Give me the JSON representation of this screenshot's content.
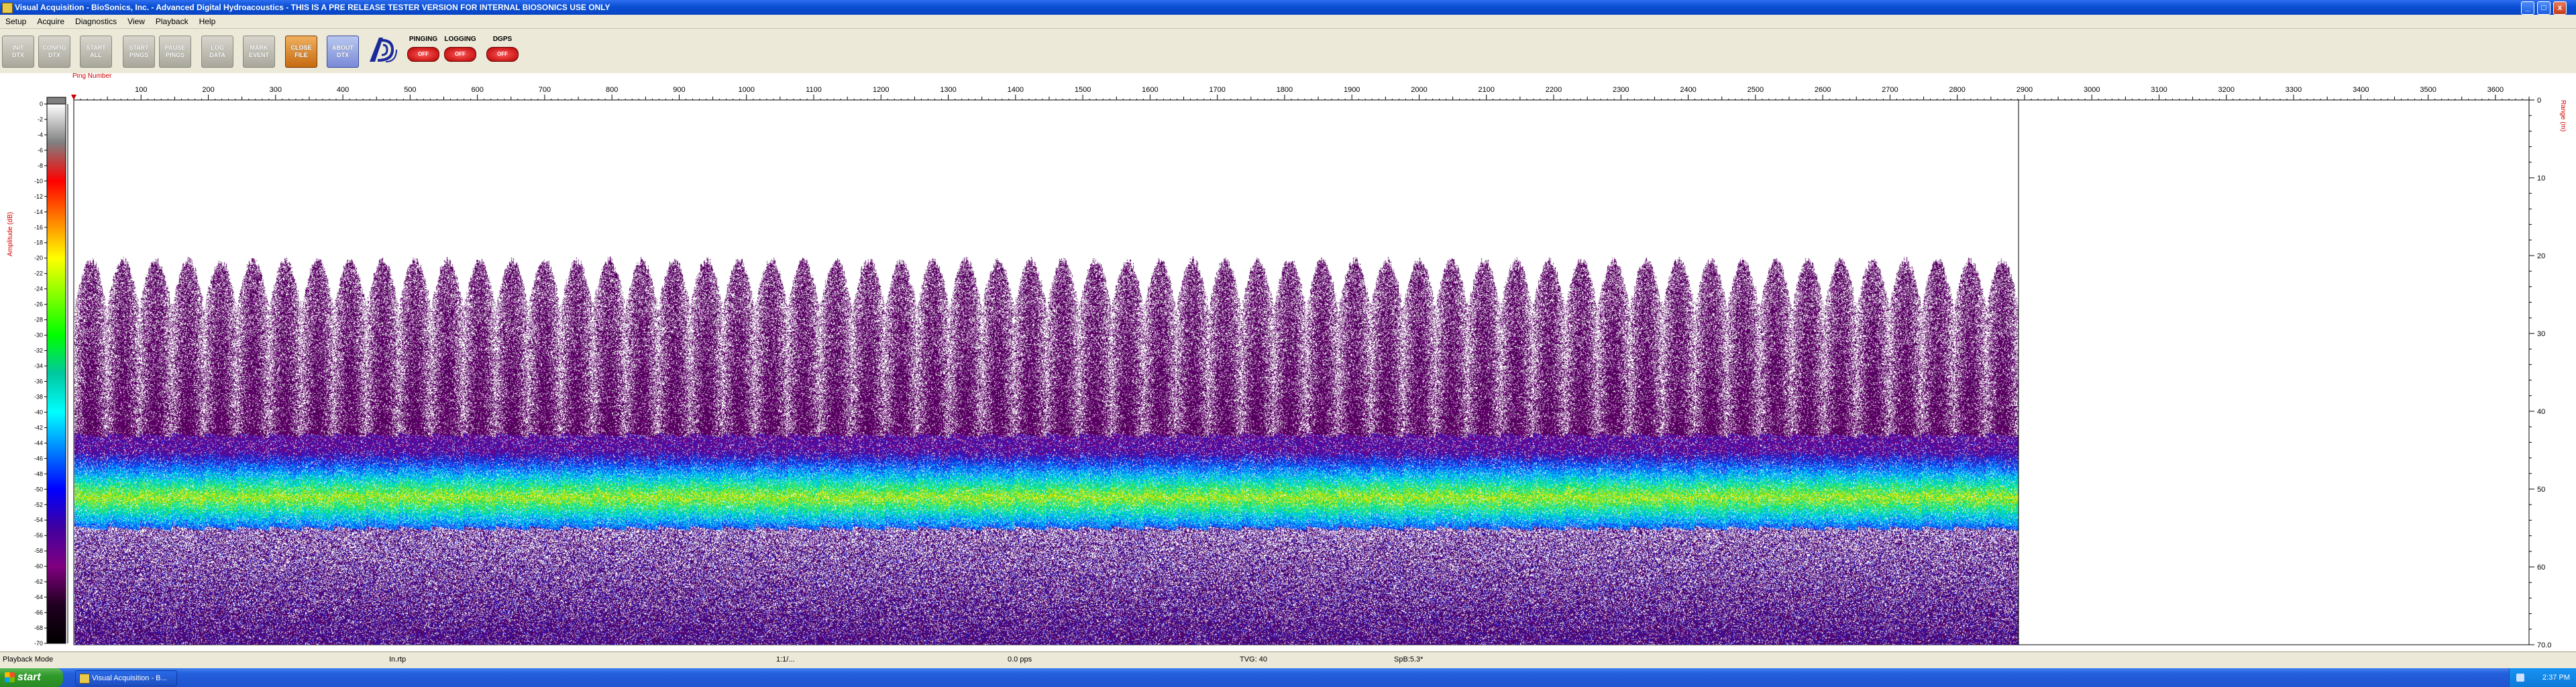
{
  "window": {
    "title": "Visual Acquisition  -  BioSonics, Inc.  -  Advanced Digital Hydroacoustics  -  THIS IS A PRE RELEASE TESTER VERSION FOR INTERNAL BIOSONICS USE ONLY",
    "minimize_label": "_",
    "maximize_label": "□",
    "close_label": "x"
  },
  "menu": {
    "items": [
      "Setup",
      "Acquire",
      "Diagnostics",
      "View",
      "Playback",
      "Help"
    ]
  },
  "toolbar": {
    "buttons": [
      {
        "label_line1": "INIT",
        "label_line2": "DTX",
        "style": "gray"
      },
      {
        "label_line1": "CONFIG",
        "label_line2": "DTX",
        "style": "gray"
      },
      {
        "label_line1": "START",
        "label_line2": "ALL",
        "style": "gray"
      },
      {
        "label_line1": "START",
        "label_line2": "PINGS",
        "style": "gray"
      },
      {
        "label_line1": "PAUSE",
        "label_line2": "PINGS",
        "style": "gray"
      },
      {
        "label_line1": "LOG",
        "label_line2": "DATA",
        "style": "gray"
      },
      {
        "label_line1": "MARK",
        "label_line2": "EVENT",
        "style": "gray"
      },
      {
        "label_line1": "CLOSE",
        "label_line2": "FILE",
        "style": "orange"
      },
      {
        "label_line1": "ABOUT",
        "label_line2": "DTX",
        "style": "blue"
      }
    ],
    "indicators": [
      {
        "label": "PINGING",
        "state": "OFF"
      },
      {
        "label": "LOGGING",
        "state": "OFF"
      },
      {
        "label": "DGPS",
        "state": "OFF"
      }
    ]
  },
  "colors": {
    "axis_label": "#d00000",
    "palette_stops": [
      "#ffffff",
      "#808080",
      "#ff0000",
      "#ff8000",
      "#ffff00",
      "#80ff00",
      "#00ff00",
      "#00c8a0",
      "#00ffff",
      "#0080ff",
      "#0000ff",
      "#4000a0",
      "#800080",
      "#200020",
      "#000000"
    ]
  },
  "chart_data": {
    "type": "heatmap",
    "title": "",
    "xlabel": "Ping Number",
    "ylabel_left": "Amplitude (dB)",
    "ylabel_right": "Range (m)",
    "x_ticks": [
      100,
      200,
      300,
      400,
      500,
      600,
      700,
      800,
      900,
      1000,
      1100,
      1200,
      1300,
      1400,
      1500,
      1600,
      1700,
      1800,
      1900,
      2000,
      2100,
      2200,
      2300,
      2400,
      2500,
      2600,
      2700,
      2800,
      2900,
      3000,
      3100,
      3200,
      3300,
      3400,
      3500,
      3600
    ],
    "xlim": [
      0,
      3650
    ],
    "range_ticks": [
      0,
      10,
      20,
      30,
      40,
      50,
      60,
      70.0
    ],
    "range_tick_labels": [
      "0",
      "10",
      "20",
      "30",
      "40",
      "50",
      "60",
      "70.0"
    ],
    "ylim_range": [
      0,
      70
    ],
    "amplitude_ticks": [
      0,
      -2,
      -4,
      -6,
      -8,
      -10,
      -12,
      -14,
      -16,
      -18,
      -20,
      -22,
      -24,
      -26,
      -28,
      -30,
      -32,
      -34,
      -36,
      -38,
      -40,
      -42,
      -44,
      -46,
      -48,
      -50,
      -52,
      -54,
      -56,
      -58,
      -60,
      -62,
      -64,
      -66,
      -68,
      -70
    ],
    "amplitude_range": [
      -70,
      0
    ],
    "data_extent_pings": 2890,
    "scatter_top_range_m": 20,
    "bottom_band_range_m": [
      43,
      55
    ],
    "bottom_peak_range_m": 51,
    "cycle_count": 60
  },
  "statusbar": {
    "mode": "Playback Mode",
    "field2": "In.rtp",
    "field3": "1:1/...",
    "field4": "0.0 pps",
    "field5": "TVG: 40",
    "field6": "SpB:5.3*"
  },
  "taskbar": {
    "start_label": "start",
    "task_label": "Visual Acquisition - B...",
    "clock": "2:37 PM"
  }
}
